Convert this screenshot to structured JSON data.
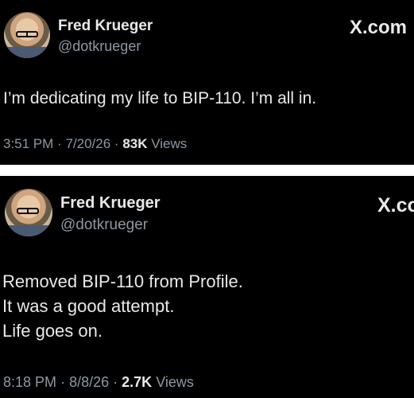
{
  "tweets": [
    {
      "author_name": "Fred Krueger",
      "author_handle": "@dotkrueger",
      "brand": "X.com",
      "text_lines": [
        "I’m dedicating my life to BIP-110. I’m all in."
      ],
      "time": "3:51 PM",
      "date": "7/20/26",
      "views_count": "83K",
      "views_label": "Views"
    },
    {
      "author_name": "Fred Krueger",
      "author_handle": "@dotkrueger",
      "brand": "X.co",
      "text_lines": [
        "Removed BIP-110 from Profile.",
        "It was a good attempt.",
        "Life goes on."
      ],
      "time": "8:18 PM",
      "date": "8/8/26",
      "views_count": "2.7K",
      "views_label": "Views"
    }
  ],
  "separator": "·",
  "colors": {
    "background": "#000000",
    "text": "#e7e9ea",
    "muted": "#8b98a5",
    "divider": "#ffffff"
  },
  "icons": [
    "avatar"
  ]
}
